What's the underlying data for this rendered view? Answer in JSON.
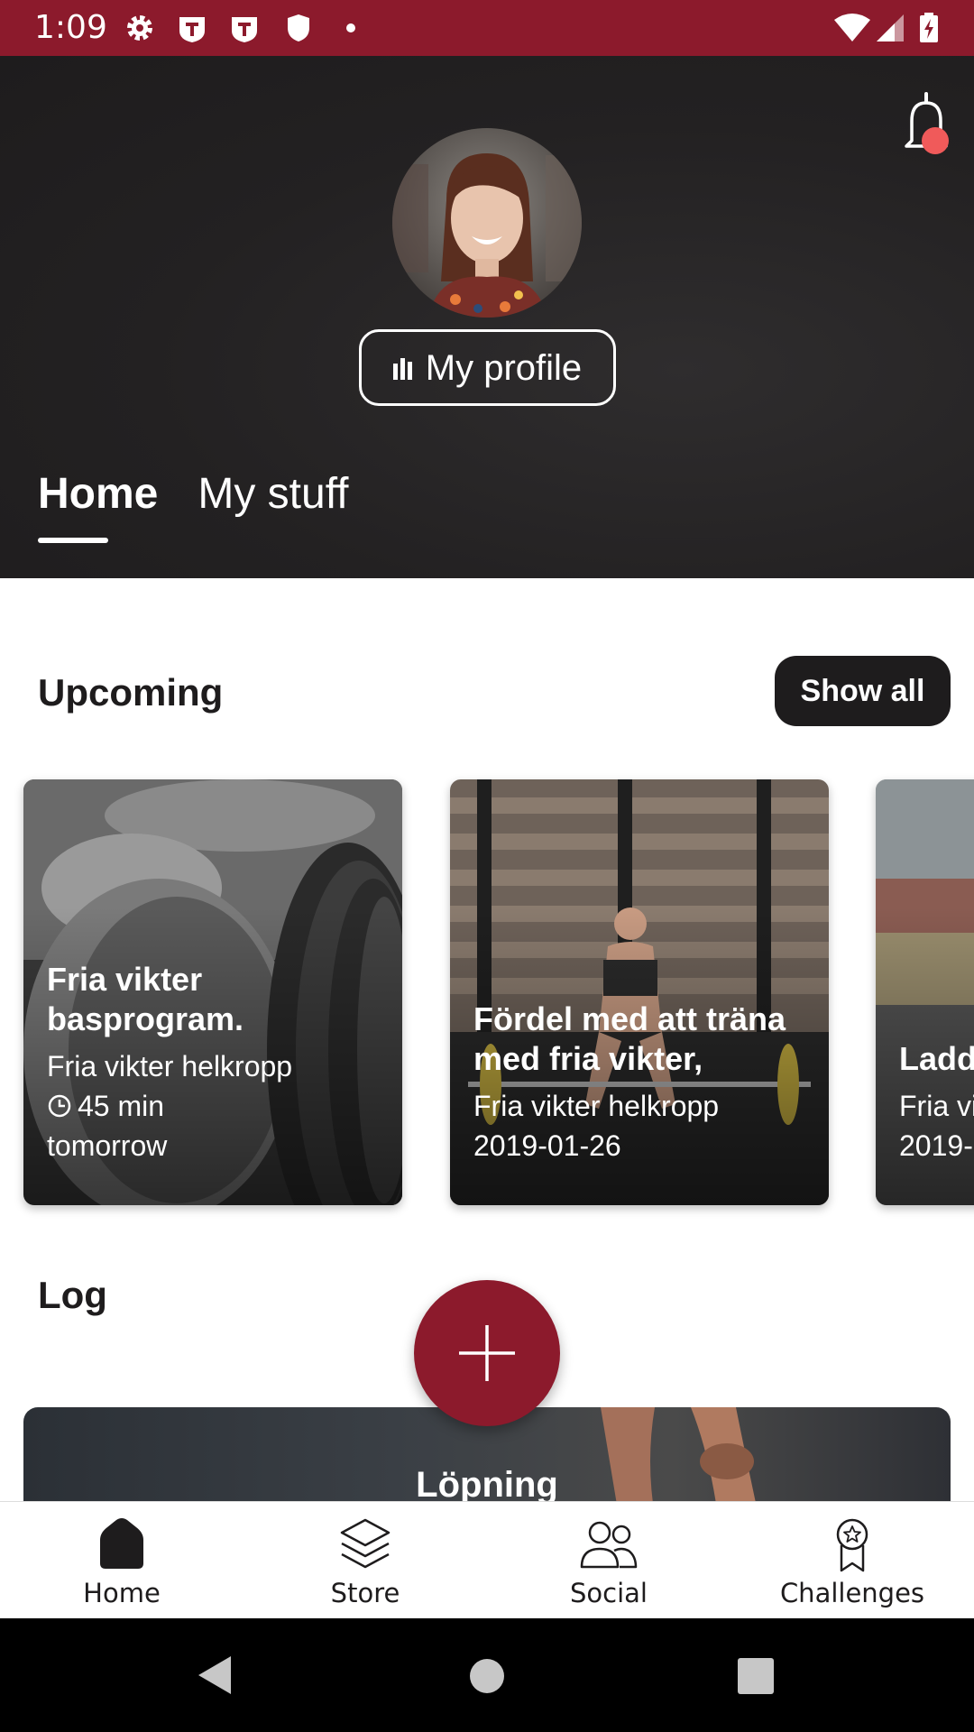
{
  "status_bar": {
    "time": "1:09",
    "icons": [
      "settings-icon",
      "t-app-icon",
      "t-app-icon",
      "shield-icon",
      "dot-icon",
      "wifi-icon",
      "signal-icon",
      "battery-icon"
    ]
  },
  "header": {
    "profile_button": "My profile",
    "tabs": [
      {
        "label": "Home",
        "active": true
      },
      {
        "label": "My stuff",
        "active": false
      }
    ]
  },
  "upcoming": {
    "title": "Upcoming",
    "show_all": "Show all",
    "cards": [
      {
        "title": "Fria vikter basprogram.",
        "subtitle": "Fria vikter helkropp",
        "duration": "45 min",
        "when": "tomorrow"
      },
      {
        "title": "Fördel med att träna med fria vikter,",
        "subtitle": "Fria vikter helkropp",
        "date": "2019-01-26"
      },
      {
        "title": "Ladda",
        "subtitle": "Fria vi",
        "date": "2019-"
      }
    ]
  },
  "log": {
    "title": "Log",
    "card_label": "Löpning"
  },
  "bottom_nav": [
    {
      "label": "Home",
      "icon": "home-icon",
      "active": true
    },
    {
      "label": "Store",
      "icon": "layers-icon",
      "active": false
    },
    {
      "label": "Social",
      "icon": "people-icon",
      "active": false
    },
    {
      "label": "Challenges",
      "icon": "badge-icon",
      "active": false
    }
  ],
  "colors": {
    "brand": "#8c1a2c",
    "dark": "#1e1c1d",
    "notification_dot": "#f05a5a"
  }
}
